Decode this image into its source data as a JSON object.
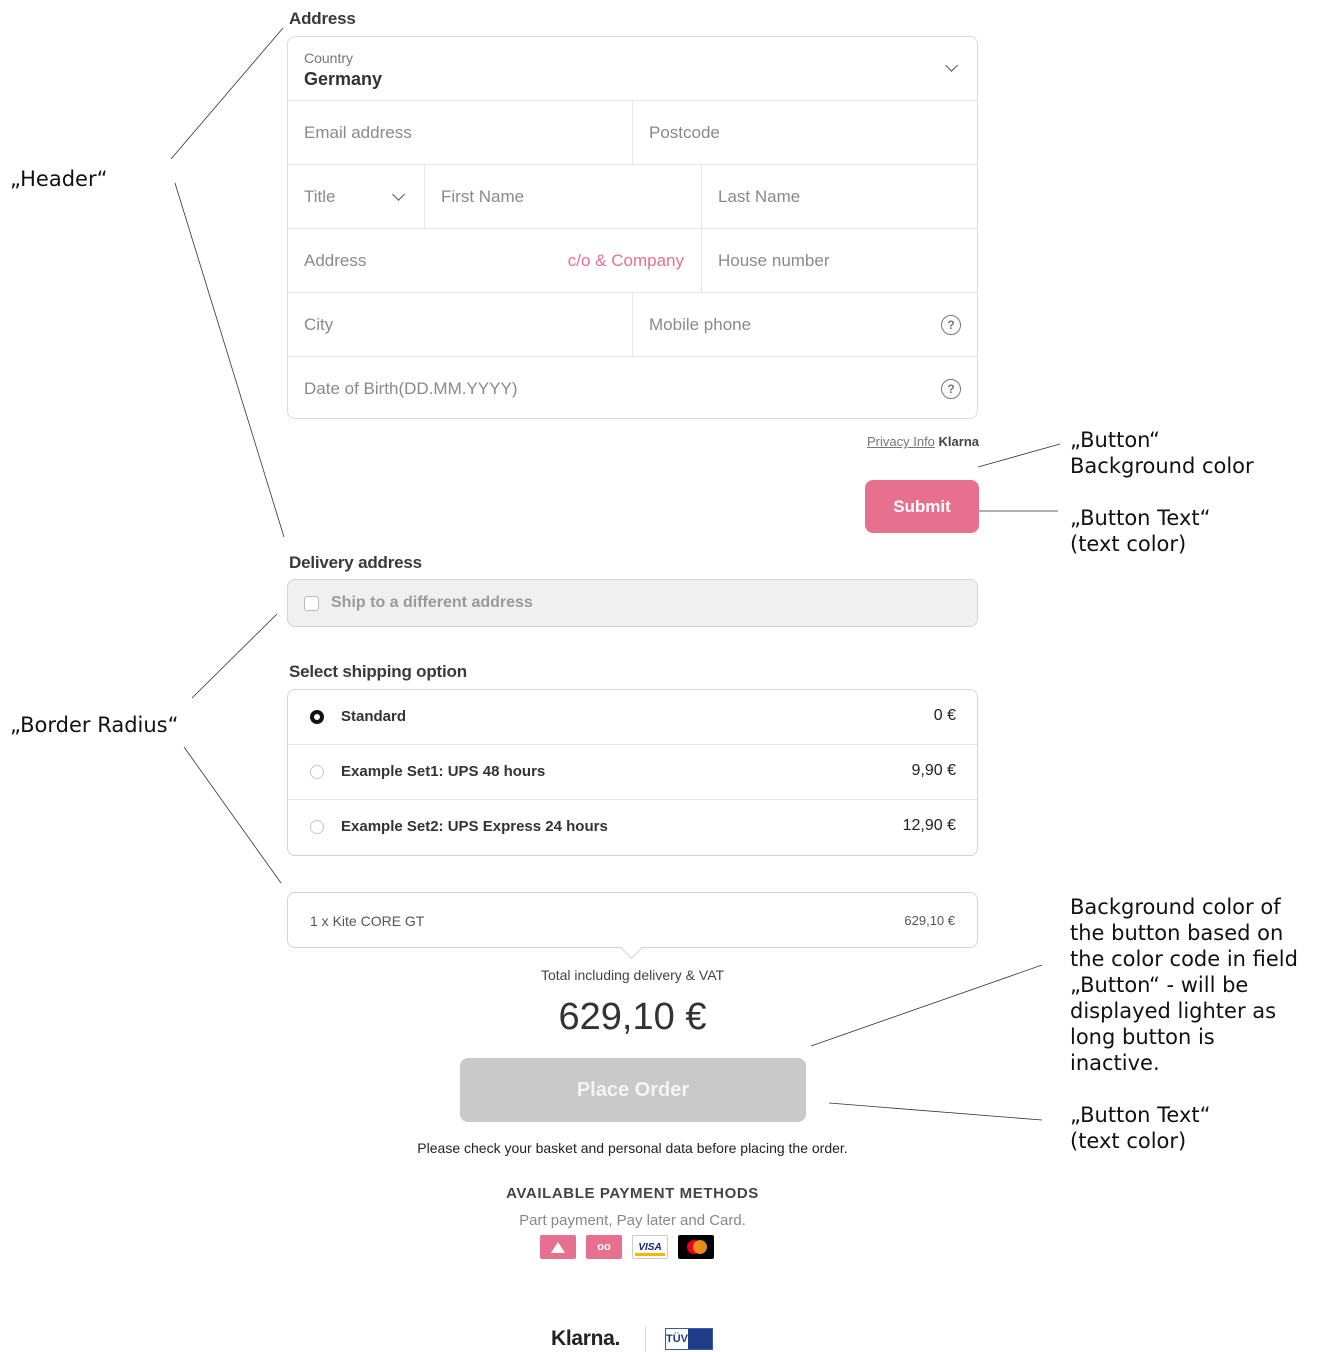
{
  "address": {
    "heading": "Address",
    "country_label": "Country",
    "country_value": "Germany",
    "email_placeholder": "Email address",
    "postcode_placeholder": "Postcode",
    "title_placeholder": "Title",
    "first_name_placeholder": "First Name",
    "last_name_placeholder": "Last Name",
    "address_placeholder": "Address",
    "co_company_link": "c/o & Company",
    "house_number_placeholder": "House number",
    "city_placeholder": "City",
    "mobile_placeholder": "Mobile phone",
    "dob_placeholder": "Date of Birth(DD.MM.YYYY)",
    "help_glyph": "?"
  },
  "privacy": {
    "link": "Privacy Info",
    "brand": "Klarna"
  },
  "submit_label": "Submit",
  "delivery": {
    "heading": "Delivery address",
    "checkbox_label": "Ship to a different address"
  },
  "shipping": {
    "heading": "Select shipping option",
    "options": [
      {
        "label": "Standard",
        "price": "0 €",
        "selected": true
      },
      {
        "label": "Example Set1: UPS 48 hours",
        "price": "9,90 €",
        "selected": false
      },
      {
        "label": "Example Set2: UPS Express 24 hours",
        "price": "12,90 €",
        "selected": false
      }
    ]
  },
  "basket": {
    "item": "1 x Kite CORE GT",
    "price": "629,10 €"
  },
  "total": {
    "label": "Total including delivery & VAT",
    "amount": "629,10 €"
  },
  "place_order_label": "Place Order",
  "note": "Please check your basket and personal data before placing the order.",
  "payment": {
    "title": "AVAILABLE PAYMENT METHODS",
    "subtitle": "Part payment, Pay later and Card.",
    "icons": [
      "klarna-pay-icon",
      "klarna-glasses-icon",
      "visa-icon",
      "mastercard-icon"
    ],
    "visa_text": "VISA"
  },
  "footer": {
    "logo": "Klarna.",
    "badge_text": "TÜV"
  },
  "colors": {
    "accent": "#e8708f",
    "inactive_button": "#c9c9c9"
  },
  "annotations": {
    "header": "„Header“",
    "border_radius": "„Border Radius“",
    "button_bg_line1": "„Button“",
    "button_bg_line2": "Background color",
    "button_text_line1": "„Button Text“",
    "button_text_line2": "(text color)",
    "inactive_note": [
      "Background color of",
      "the button based on",
      "the color code in field",
      "„Button“ - will be",
      "displayed lighter as",
      "long button is",
      "inactive."
    ],
    "button_text2_line1": "„Button Text“",
    "button_text2_line2": "(text color)"
  }
}
